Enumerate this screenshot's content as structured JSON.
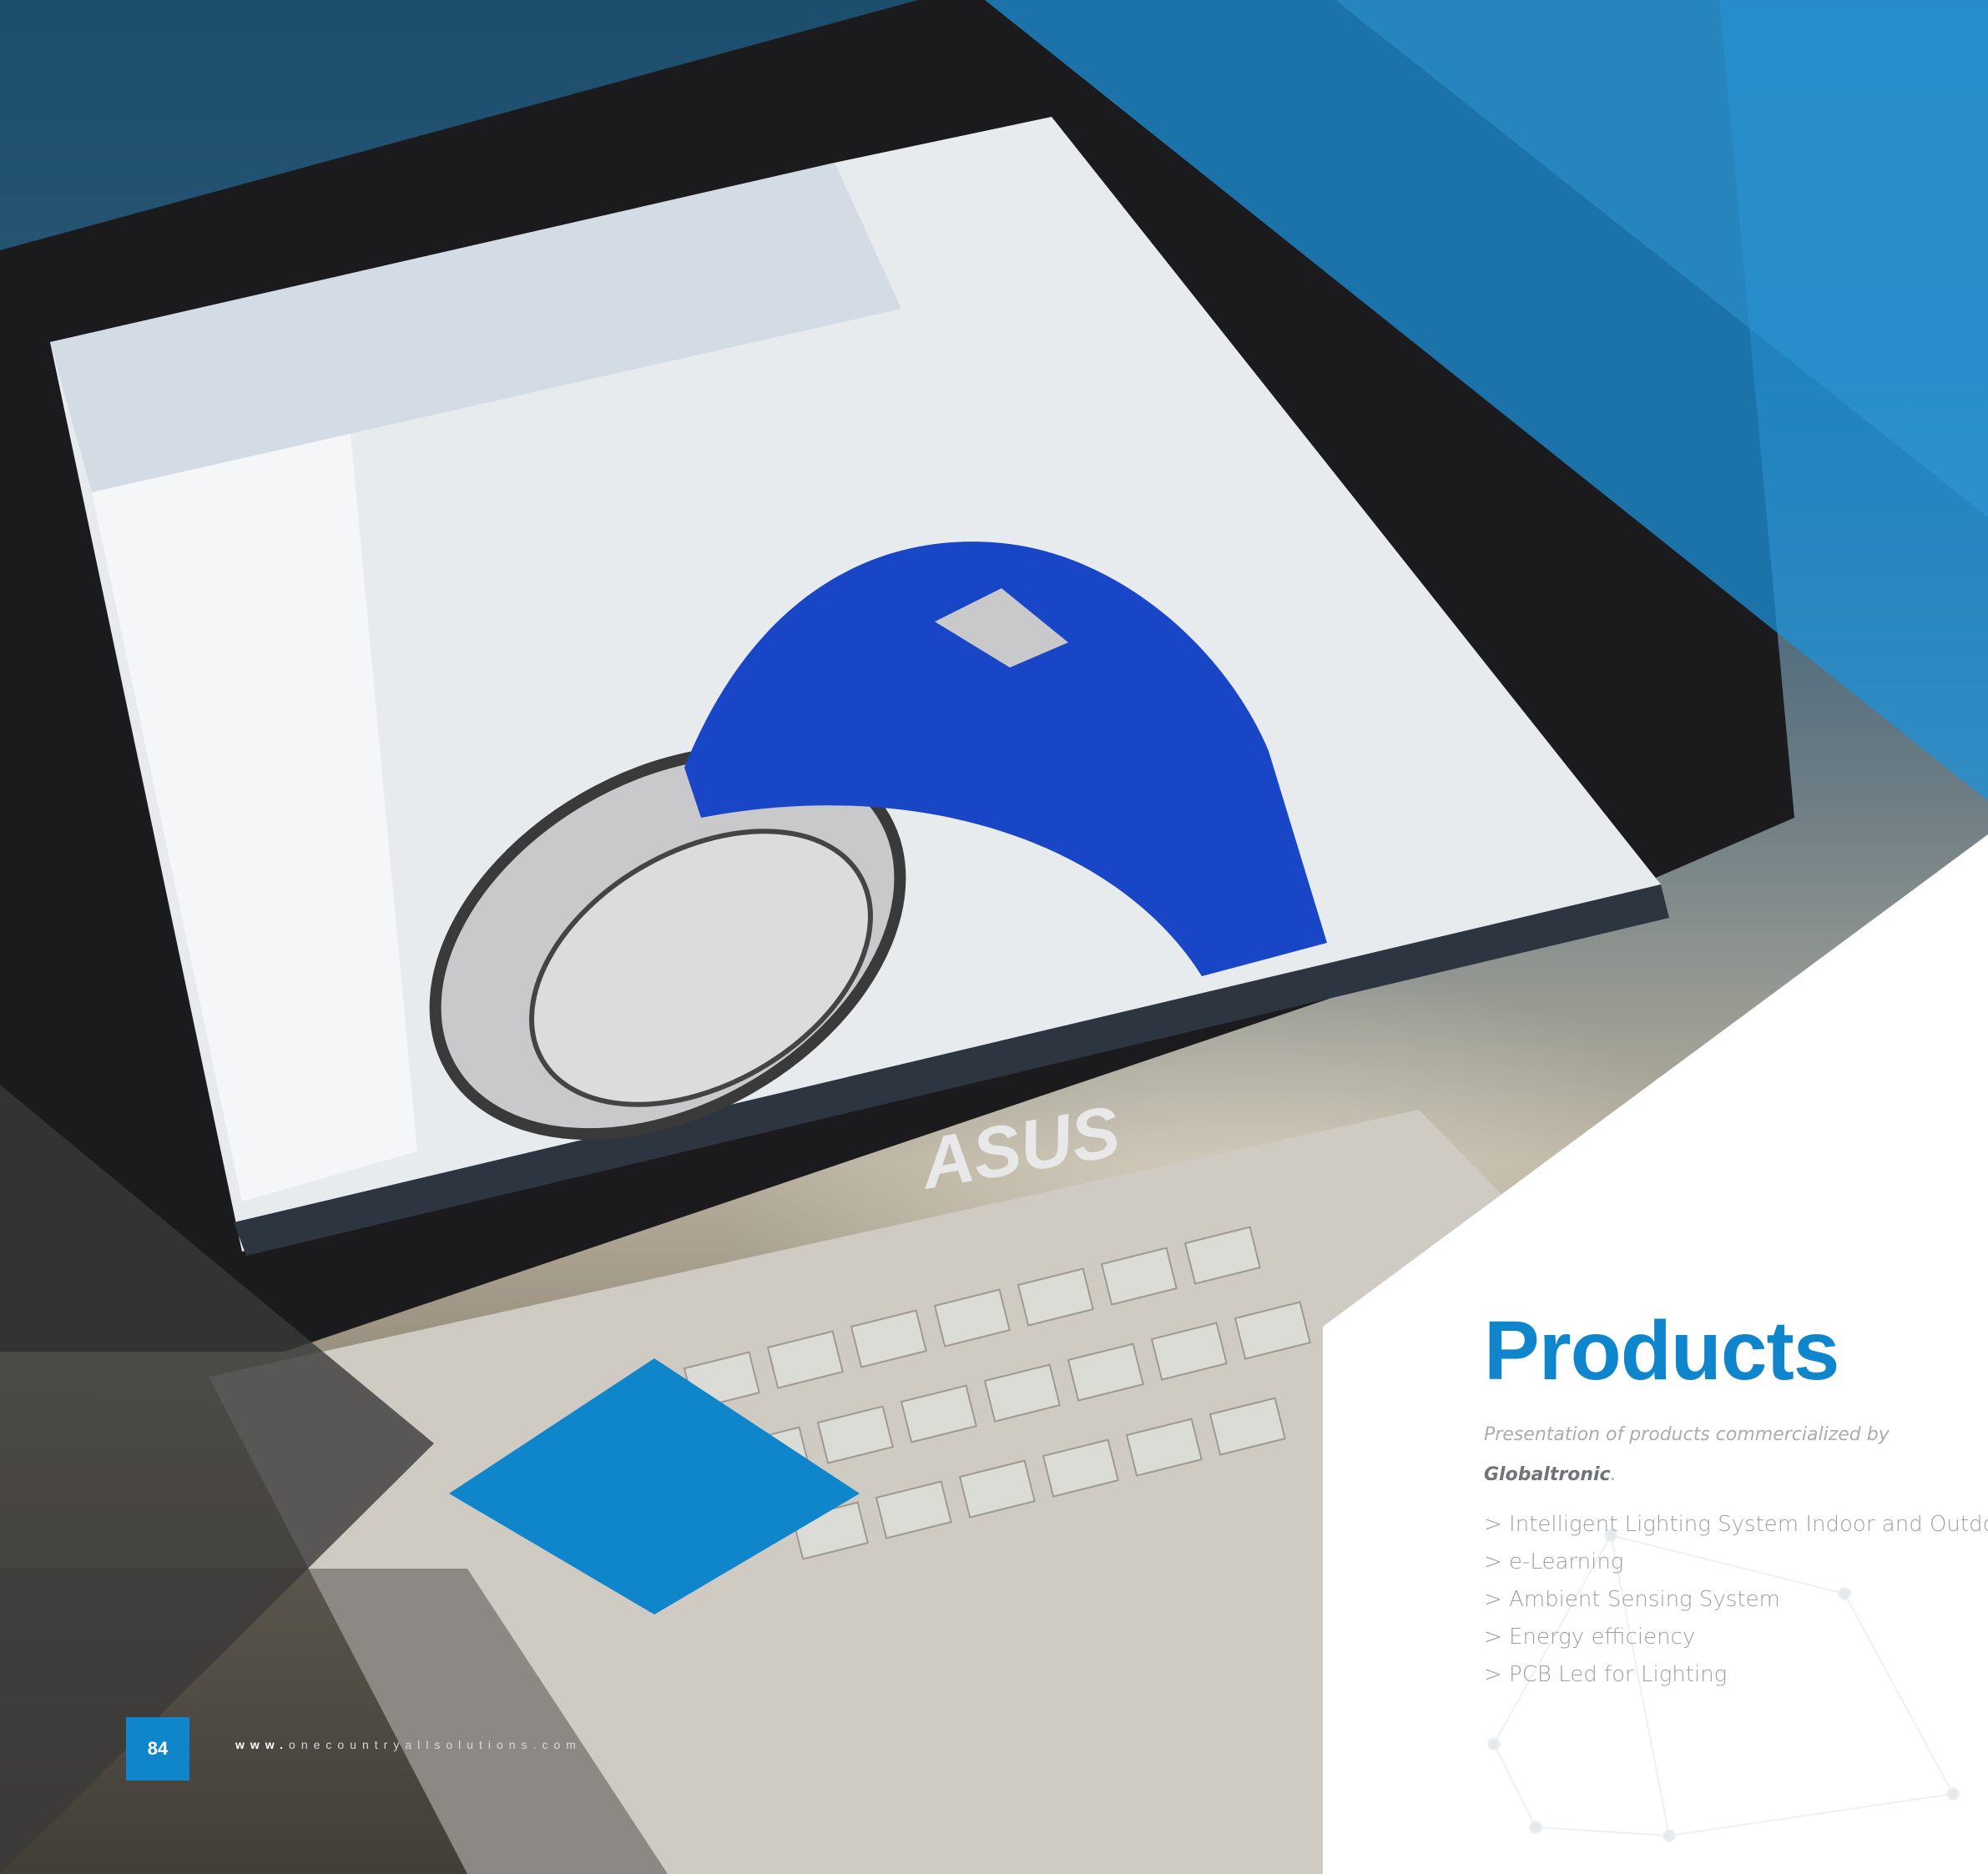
{
  "photo": {
    "description_icon": "laptop-photo",
    "laptop_brand_logo": "ASUS"
  },
  "content": {
    "title": "Products",
    "subtitle_text": "Presentation of products commercialized by",
    "subtitle_brand": "Globaltronic",
    "subtitle_end": ".",
    "products": [
      "> Intelligent Lighting System Indoor and Outdoor",
      "> e-Learning",
      "> Ambient Sensing System",
      "> Energy efficiency",
      "> PCB Led for Lighting"
    ]
  },
  "footer": {
    "page_number": "84",
    "website_prefix": "www.",
    "website_domain": "onecountryallsolutions.com"
  },
  "colors": {
    "accent_blue": "#0f86cc",
    "dark_gray": "#3a3a3a",
    "text_gray": "#9aa0a6"
  }
}
